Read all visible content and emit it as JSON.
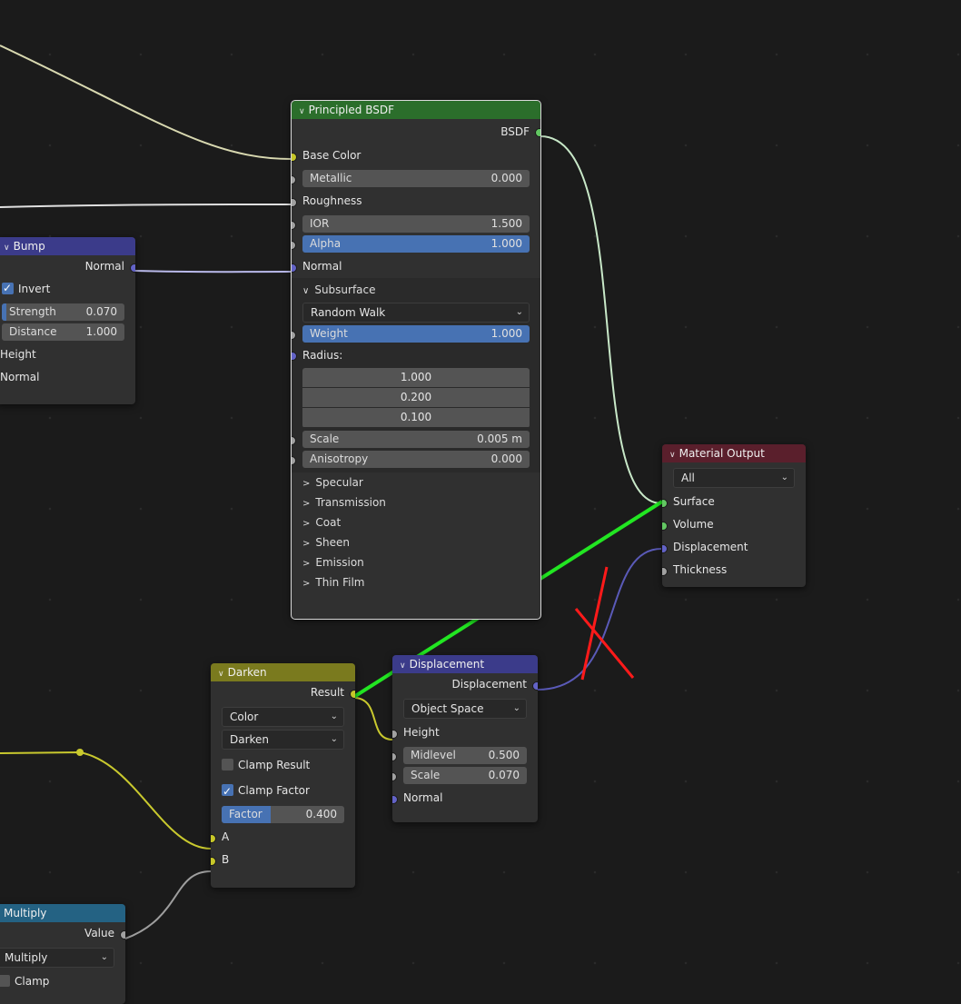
{
  "colors": {
    "background": "#1b1b1b",
    "node_body": "#303030",
    "header_shader": "#2b6e2b",
    "header_vector": "#3b3b8a",
    "header_color": "#7a7a1e",
    "header_output": "#5a1f2c",
    "header_converter": "#246283",
    "field_blue": "#4772b3",
    "link_green": "#22e622",
    "annotation_red": "#ff1a1a"
  },
  "principled": {
    "title": "Principled BSDF",
    "output_bsdf": "BSDF",
    "base_color": "Base Color",
    "metallic_label": "Metallic",
    "metallic_value": "0.000",
    "roughness": "Roughness",
    "ior_label": "IOR",
    "ior_value": "1.500",
    "alpha_label": "Alpha",
    "alpha_value": "1.000",
    "normal": "Normal",
    "subsurface_panel": "Subsurface",
    "subsurface_method": "Random Walk",
    "weight_label": "Weight",
    "weight_value": "1.000",
    "radius_label": "Radius:",
    "radius_values": [
      "1.000",
      "0.200",
      "0.100"
    ],
    "scale_label": "Scale",
    "scale_value": "0.005 m",
    "anisotropy_label": "Anisotropy",
    "anisotropy_value": "0.000",
    "panels": [
      "Specular",
      "Transmission",
      "Coat",
      "Sheen",
      "Emission",
      "Thin Film"
    ]
  },
  "bump": {
    "title": "Bump",
    "output_normal": "Normal",
    "invert_label": "Invert",
    "strength_label": "Strength",
    "strength_value": "0.070",
    "distance_label": "Distance",
    "distance_value": "1.000",
    "height": "Height",
    "normal": "Normal"
  },
  "material_output": {
    "title": "Material Output",
    "target": "All",
    "surface": "Surface",
    "volume": "Volume",
    "displacement": "Displacement",
    "thickness": "Thickness"
  },
  "darken": {
    "title": "Darken",
    "output_result": "Result",
    "type_select": "Color",
    "blend_select": "Darken",
    "clamp_result": "Clamp Result",
    "clamp_factor": "Clamp Factor",
    "factor_label": "Factor",
    "factor_value": "0.400",
    "factor_fraction": 0.4,
    "input_a": "A",
    "input_b": "B"
  },
  "displacement": {
    "title": "Displacement",
    "output": "Displacement",
    "space_select": "Object Space",
    "height": "Height",
    "midlevel_label": "Midlevel",
    "midlevel_value": "0.500",
    "scale_label": "Scale",
    "scale_value": "0.070",
    "normal": "Normal"
  },
  "math": {
    "title": "Multiply",
    "output_value": "Value",
    "operation_select": "Multiply",
    "clamp_label": "Clamp"
  }
}
